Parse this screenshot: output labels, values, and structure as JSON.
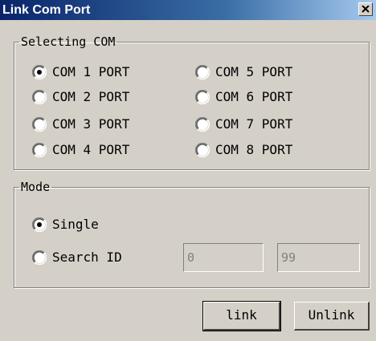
{
  "window": {
    "title": "Link Com Port",
    "close_icon": "close-icon"
  },
  "com_group": {
    "legend": "Selecting COM",
    "ports": [
      {
        "label": "COM 1 PORT",
        "selected": true
      },
      {
        "label": "COM 2 PORT",
        "selected": false
      },
      {
        "label": "COM 3 PORT",
        "selected": false
      },
      {
        "label": "COM 4 PORT",
        "selected": false
      },
      {
        "label": "COM 5 PORT",
        "selected": false
      },
      {
        "label": "COM 6 PORT",
        "selected": false
      },
      {
        "label": "COM 7 PORT",
        "selected": false
      },
      {
        "label": "COM 8 PORT",
        "selected": false
      }
    ]
  },
  "mode_group": {
    "legend": "Mode",
    "single_label": "Single",
    "single_selected": true,
    "search_label": "Search ID",
    "search_selected": false,
    "id_from": "0",
    "id_to": "99"
  },
  "buttons": {
    "link": "link",
    "unlink": "Unlink"
  }
}
